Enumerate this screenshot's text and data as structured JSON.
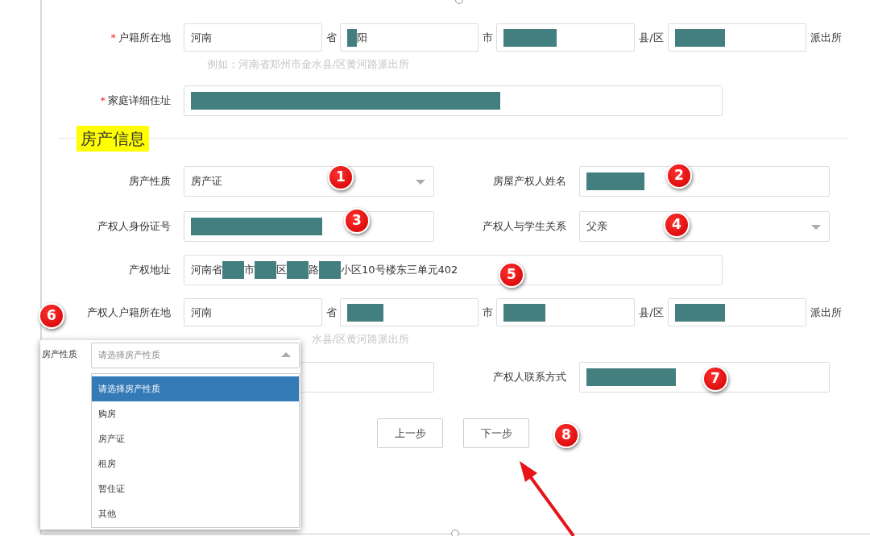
{
  "rows": [
    {
      "kind": "region",
      "marker": "*",
      "label": "户籍所在地",
      "segments": [
        {
          "parts": [
            {
              "kind": "text",
              "text": "河南"
            }
          ],
          "suffix": "省"
        },
        {
          "parts": [
            {
              "kind": "redaction"
            },
            {
              "kind": "text",
              "text": "阳"
            }
          ],
          "suffix": "市"
        },
        {
          "parts": [
            {
              "kind": "redaction"
            }
          ],
          "suffix": "县/区"
        },
        {
          "parts": [
            {
              "kind": "redaction"
            }
          ],
          "suffix": "派出所"
        }
      ],
      "hint": "例如：河南省郑州市金水县/区黄河路派出所"
    },
    {
      "kind": "wide",
      "marker": "*",
      "label": "家庭详细住址",
      "parts": [
        {
          "kind": "redaction"
        }
      ]
    },
    {
      "kind": "section",
      "title": "房产信息"
    },
    {
      "kind": "pair",
      "fields": [
        {
          "label": "房产性质",
          "kind": "select",
          "parts": [
            {
              "kind": "text",
              "text": "房产证"
            }
          ]
        },
        {
          "label": "房屋产权人姓名",
          "kind": "input",
          "parts": [
            {
              "kind": "redaction"
            }
          ]
        }
      ]
    },
    {
      "kind": "pair",
      "fields": [
        {
          "label": "产权人身份证号",
          "kind": "input",
          "parts": [
            {
              "kind": "redaction"
            }
          ]
        },
        {
          "label": "产权人与学生关系",
          "kind": "select",
          "parts": [
            {
              "kind": "text",
              "text": "父亲"
            }
          ]
        }
      ]
    },
    {
      "kind": "wide",
      "label": "产权地址",
      "parts": [
        {
          "kind": "text",
          "text": "河南省"
        },
        {
          "kind": "redaction"
        },
        {
          "kind": "text",
          "text": "市"
        },
        {
          "kind": "redaction"
        },
        {
          "kind": "text",
          "text": "区"
        },
        {
          "kind": "redaction"
        },
        {
          "kind": "text",
          "text": "路"
        },
        {
          "kind": "redaction"
        },
        {
          "kind": "text",
          "text": "小区10号楼东三单元402"
        }
      ]
    },
    {
      "kind": "region",
      "label": "产权人户籍所在地",
      "segments": [
        {
          "parts": [
            {
              "kind": "text",
              "text": "河南"
            }
          ],
          "suffix": "省"
        },
        {
          "parts": [
            {
              "kind": "redaction"
            }
          ],
          "suffix": "市"
        },
        {
          "parts": [
            {
              "kind": "redaction"
            }
          ],
          "suffix": "县/区"
        },
        {
          "parts": [
            {
              "kind": "redaction"
            }
          ],
          "suffix": "派出所"
        }
      ],
      "hint": "水县/区黄河路派出所"
    },
    {
      "kind": "pair",
      "fields": [
        {
          "kind": "input"
        },
        {
          "label": "产权人联系方式",
          "kind": "input",
          "parts": [
            {
              "kind": "redaction"
            }
          ]
        }
      ]
    }
  ],
  "buttons": [
    "上一步",
    "下一步"
  ],
  "dropdown": {
    "label": "房产性质",
    "placeholder": "请选择房产性质",
    "options": [
      {
        "text": "请选择房产性质",
        "selected": true
      },
      {
        "text": "购房",
        "selected": false
      },
      {
        "text": "房产证",
        "selected": false
      },
      {
        "text": "租房",
        "selected": false
      },
      {
        "text": "暂住证",
        "selected": false
      },
      {
        "text": "其他",
        "selected": false
      }
    ]
  },
  "annotations": [
    "1",
    "2",
    "3",
    "4",
    "5",
    "6",
    "7",
    "8"
  ]
}
